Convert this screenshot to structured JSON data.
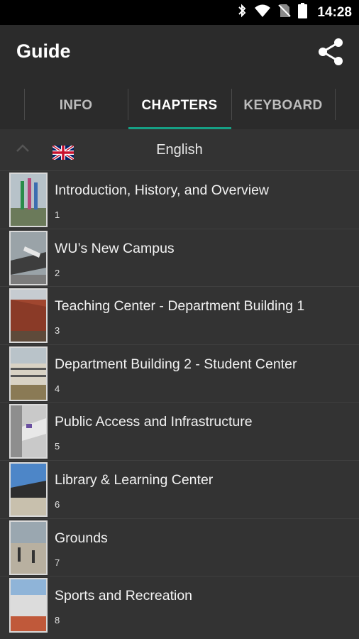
{
  "status": {
    "time": "14:28"
  },
  "app": {
    "title": "Guide"
  },
  "tabs": [
    {
      "label": "INFO",
      "active": false
    },
    {
      "label": "CHAPTERS",
      "active": true
    },
    {
      "label": "KEYBOARD",
      "active": false
    }
  ],
  "language": {
    "label": "English"
  },
  "chapters": [
    {
      "title": "Introduction, History, and Overview",
      "number": "1"
    },
    {
      "title": "WU’s New Campus",
      "number": "2"
    },
    {
      "title": "Teaching Center - Department Building 1",
      "number": "3"
    },
    {
      "title": "Department Building 2 - Student Center",
      "number": "4"
    },
    {
      "title": "Public Access and Infrastructure",
      "number": "5"
    },
    {
      "title": "Library & Learning Center",
      "number": "6"
    },
    {
      "title": "Grounds",
      "number": "7"
    },
    {
      "title": "Sports and Recreation",
      "number": "8"
    }
  ],
  "colors": {
    "background": "#333333",
    "app_bar": "#2b2b2b",
    "accent": "#16a085",
    "status_bar": "#000000"
  }
}
